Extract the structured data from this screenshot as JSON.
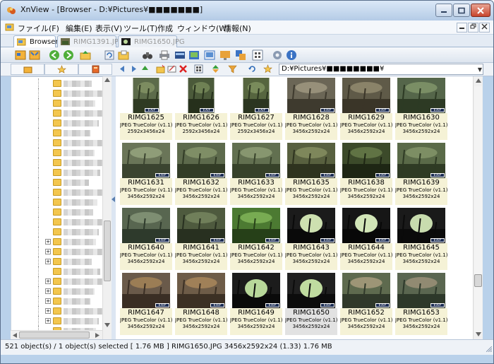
{
  "window": {
    "title": "XnView - [Browser - D:¥Pictures¥■■■■■■■]"
  },
  "menu": [
    {
      "label": "ファイル(F)"
    },
    {
      "label": "編集(E)"
    },
    {
      "label": "表示(V)"
    },
    {
      "label": "ツール(T)"
    },
    {
      "label": "作成"
    },
    {
      "label": "ウィンドウ(W)"
    },
    {
      "label": "情報(N)"
    }
  ],
  "tabs": [
    {
      "label": "Browser"
    },
    {
      "label": "RIMG1391.JPG"
    },
    {
      "label": "RIMG1650.JPG"
    }
  ],
  "address": {
    "value": "D:¥Pictures¥■■■■■■■■¥"
  },
  "thumbnails": [
    {
      "name": "RIMG1625",
      "type": "JPEG TrueColor (v1.1)",
      "dims": "2592x3456x24"
    },
    {
      "name": "RIMG1626",
      "type": "JPEG TrueColor (v1.1)",
      "dims": "2592x3456x24"
    },
    {
      "name": "RIMG1627",
      "type": "JPEG TrueColor (v1.1)",
      "dims": "2592x3456x24"
    },
    {
      "name": "RIMG1628",
      "type": "JPEG TrueColor (v1.1)",
      "dims": "3456x2592x24"
    },
    {
      "name": "RIMG1629",
      "type": "JPEG TrueColor (v1.1)",
      "dims": "3456x2592x24"
    },
    {
      "name": "RIMG1630",
      "type": "JPEG TrueColor (v1.1)",
      "dims": "3456x2592x24"
    },
    {
      "name": "RIMG1631",
      "type": "JPEG TrueColor (v1.1)",
      "dims": "3456x2592x24"
    },
    {
      "name": "RIMG1632",
      "type": "JPEG TrueColor (v1.1)",
      "dims": "3456x2592x24"
    },
    {
      "name": "RIMG1633",
      "type": "JPEG TrueColor (v1.1)",
      "dims": "3456x2592x24"
    },
    {
      "name": "RIMG1635",
      "type": "JPEG TrueColor (v1.1)",
      "dims": "3456x2592x24"
    },
    {
      "name": "RIMG1638",
      "type": "JPEG TrueColor (v1.1)",
      "dims": "3456x2592x24"
    },
    {
      "name": "RIMG1639",
      "type": "JPEG TrueColor (v1.1)",
      "dims": "3456x2592x24"
    },
    {
      "name": "RIMG1640",
      "type": "JPEG TrueColor (v1.1)",
      "dims": "3456x2592x24"
    },
    {
      "name": "RIMG1641",
      "type": "JPEG TrueColor (v1.1)",
      "dims": "3456x2592x24"
    },
    {
      "name": "RIMG1642",
      "type": "JPEG TrueColor (v1.1)",
      "dims": "3456x2592x24"
    },
    {
      "name": "RIMG1643",
      "type": "JPEG TrueColor (v1.1)",
      "dims": "3456x2592x24"
    },
    {
      "name": "RIMG1644",
      "type": "JPEG TrueColor (v1.1)",
      "dims": "3456x2592x24"
    },
    {
      "name": "RIMG1645",
      "type": "JPEG TrueColor (v1.1)",
      "dims": "3456x2592x24"
    },
    {
      "name": "RIMG1647",
      "type": "JPEG TrueColor (v1.1)",
      "dims": "3456x2592x24"
    },
    {
      "name": "RIMG1648",
      "type": "JPEG TrueColor (v1.1)",
      "dims": "3456x2592x24"
    },
    {
      "name": "RIMG1649",
      "type": "JPEG TrueColor (v1.1)",
      "dims": "3456x2592x24"
    },
    {
      "name": "RIMG1650",
      "type": "JPEG TrueColor (v1.1)",
      "dims": "3456x2592x24",
      "selected": true
    },
    {
      "name": "RIMG1652",
      "type": "JPEG TrueColor (v1.1)",
      "dims": "3456x2592x24"
    },
    {
      "name": "RIMG1653",
      "type": "JPEG TrueColor (v1.1)",
      "dims": "3456x2592x24"
    }
  ],
  "badge_label": "EXIF",
  "status": {
    "text": "521 object(s) / 1 object(s) selected  [ 1.76 MB ]  RIMG1650.JPG  3456x2592x24 (1.33)  1.76 MB"
  },
  "colors": {
    "accent": "#3a6ea5",
    "caption_bg": "#f5f2d6",
    "folder": "#f3c64e"
  }
}
